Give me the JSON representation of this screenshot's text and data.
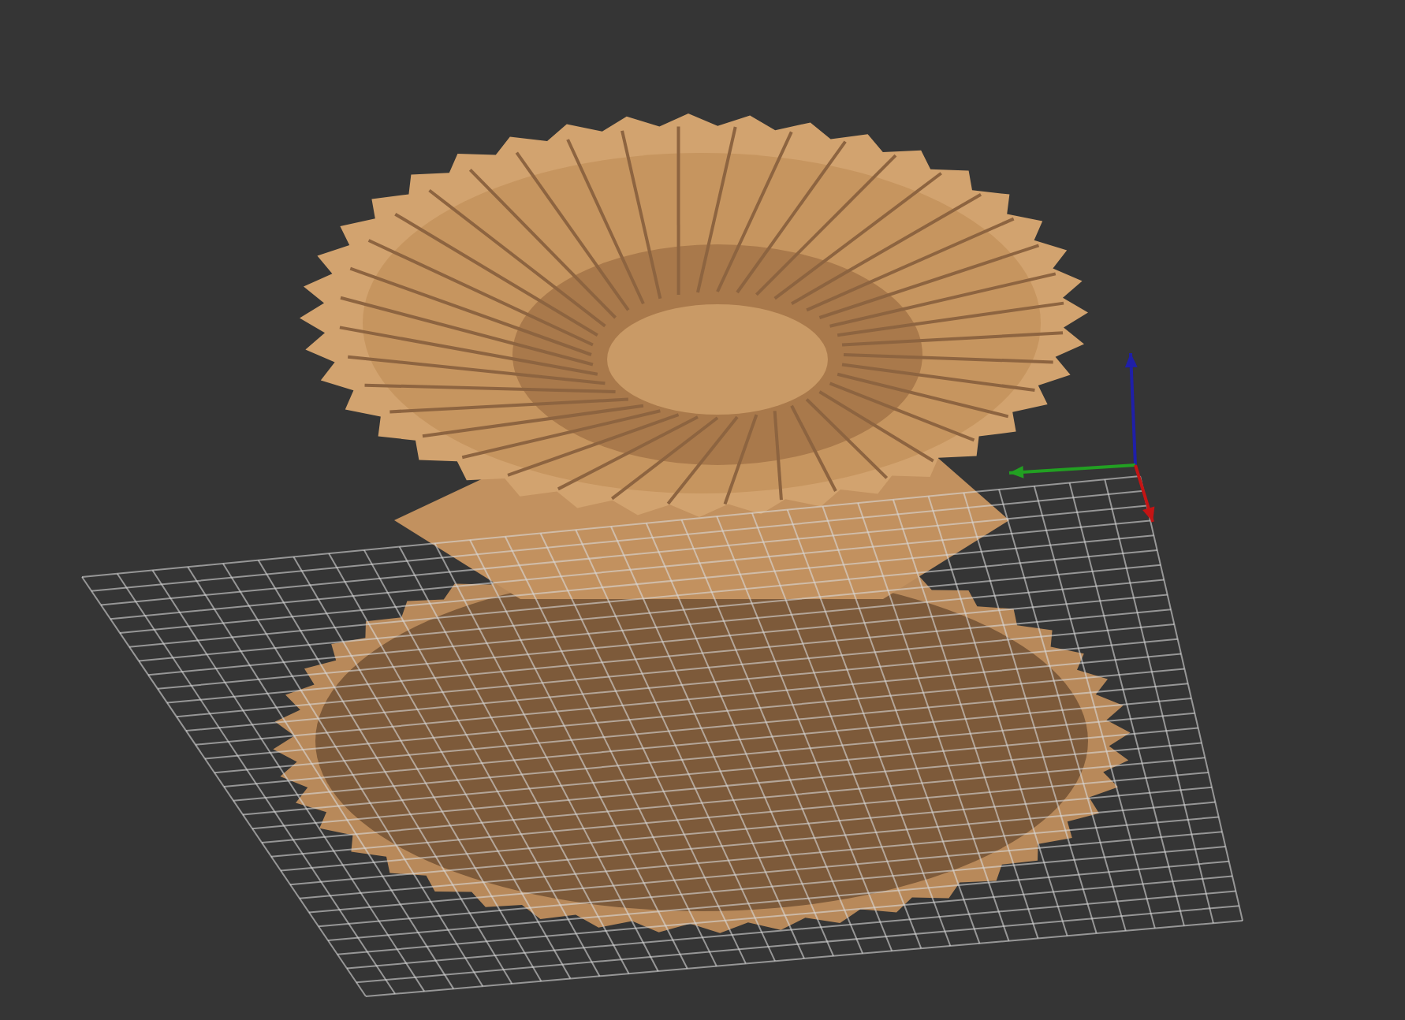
{
  "viewport": {
    "axes": [
      {
        "color": "#1f1fa8"
      },
      {
        "color": "#22a022"
      },
      {
        "color": "#c41414"
      }
    ]
  }
}
